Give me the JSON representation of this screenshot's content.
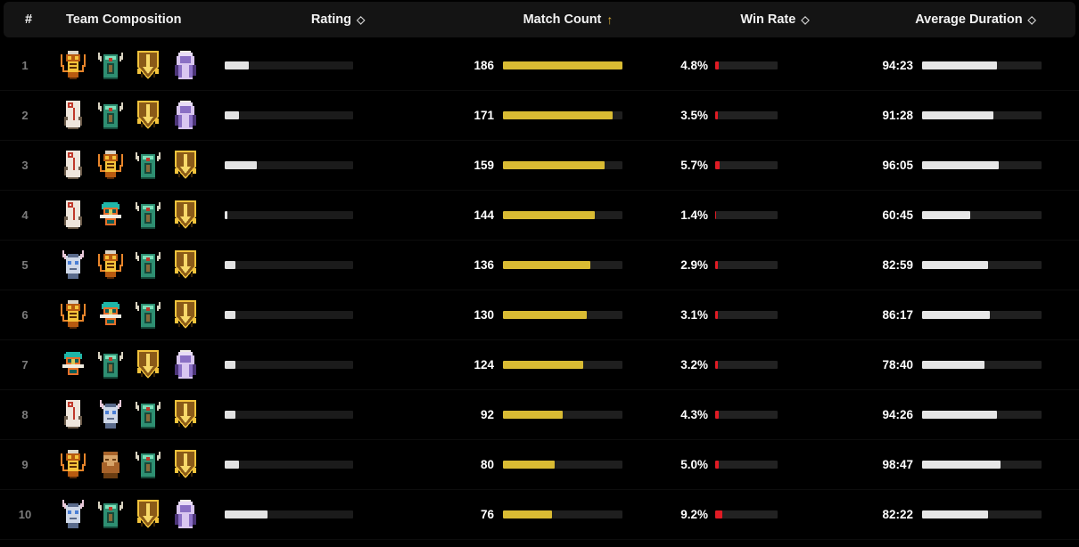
{
  "header": {
    "columns": [
      {
        "label": "#",
        "sort": "none",
        "align": "center"
      },
      {
        "label": "Team Composition",
        "sort": "none",
        "align": "left"
      },
      {
        "label": "Rating",
        "sort": "sortable",
        "align": "center"
      },
      {
        "label": "Match Count",
        "sort": "asc",
        "align": "center"
      },
      {
        "label": "Win Rate",
        "sort": "sortable",
        "align": "center"
      },
      {
        "label": "Average Duration",
        "sort": "sortable",
        "align": "center"
      }
    ],
    "sort_neutral_glyph": "◇",
    "sort_asc_glyph": "↑"
  },
  "colors": {
    "background": "#000000",
    "header_bg": "#141414",
    "rating_bar": "#e3e3e3",
    "match_bar": "#d9bb33",
    "winrate_bar": "#e01b24",
    "duration_bar": "#e6e6e6",
    "track": "#1f1f1f",
    "sort_active": "#e0b13a",
    "rank_text": "#7c7c7c",
    "value_text": "#ffffff"
  },
  "units": {
    "orange-demon": {
      "name": "orange-demon-unit",
      "body": "#b85a10",
      "accent": "#f5c33a",
      "dark": "#5a2a06",
      "horn": "#e8852a"
    },
    "green-horned": {
      "name": "green-horned-unit",
      "body": "#2e8f72",
      "accent": "#7fe0bb",
      "dark": "#15493a",
      "horn": "#d8d2c0"
    },
    "gold-shield": {
      "name": "gold-shield-unit",
      "body": "#8a5a18",
      "accent": "#f2c33c",
      "dark": "#3f2708",
      "horn": "#f7d96a"
    },
    "purple-robe": {
      "name": "purple-robe-unit",
      "body": "#8a6fc4",
      "accent": "#d9c6f0",
      "dark": "#4b3477",
      "horn": "#e8dcf7"
    },
    "white-scroll": {
      "name": "white-scroll-unit",
      "body": "#efe6dc",
      "accent": "#c0392b",
      "dark": "#6b5b4a",
      "horn": "#efe6dc"
    },
    "teal-masked": {
      "name": "teal-masked-unit",
      "body": "#1fb6a8",
      "accent": "#e8702a",
      "dark": "#0d5e57",
      "horn": "#f0ece0"
    },
    "blue-face": {
      "name": "blue-face-unit",
      "body": "#cfd8e8",
      "accent": "#4a7fd6",
      "dark": "#5a6b8c",
      "horn": "#e8c8d8"
    },
    "bearded-man": {
      "name": "bearded-warrior-unit",
      "body": "#d8a56a",
      "accent": "#a8632a",
      "dark": "#6b3d12",
      "horn": "#e8c89a"
    }
  },
  "rows": [
    {
      "rank": "1",
      "team": [
        "orange-demon",
        "green-horned",
        "gold-shield",
        "purple-robe"
      ],
      "rating": {
        "value": "",
        "pct": 19
      },
      "match": {
        "value": "186",
        "pct": 100
      },
      "win": {
        "value": "4.8%",
        "pct": 6
      },
      "duration": {
        "value": "94:23",
        "pct": 63
      }
    },
    {
      "rank": "2",
      "team": [
        "white-scroll",
        "green-horned",
        "gold-shield",
        "purple-robe"
      ],
      "rating": {
        "value": "",
        "pct": 11
      },
      "match": {
        "value": "171",
        "pct": 92
      },
      "win": {
        "value": "3.5%",
        "pct": 4
      },
      "duration": {
        "value": "91:28",
        "pct": 60
      }
    },
    {
      "rank": "3",
      "team": [
        "white-scroll",
        "orange-demon",
        "green-horned",
        "gold-shield"
      ],
      "rating": {
        "value": "",
        "pct": 25
      },
      "match": {
        "value": "159",
        "pct": 85
      },
      "win": {
        "value": "5.7%",
        "pct": 7
      },
      "duration": {
        "value": "96:05",
        "pct": 64
      }
    },
    {
      "rank": "4",
      "team": [
        "white-scroll",
        "teal-masked",
        "green-horned",
        "gold-shield"
      ],
      "rating": {
        "value": "",
        "pct": 2
      },
      "match": {
        "value": "144",
        "pct": 77
      },
      "win": {
        "value": "1.4%",
        "pct": 2
      },
      "duration": {
        "value": "60:45",
        "pct": 40
      }
    },
    {
      "rank": "5",
      "team": [
        "blue-face",
        "orange-demon",
        "green-horned",
        "gold-shield"
      ],
      "rating": {
        "value": "",
        "pct": 8
      },
      "match": {
        "value": "136",
        "pct": 73
      },
      "win": {
        "value": "2.9%",
        "pct": 4
      },
      "duration": {
        "value": "82:59",
        "pct": 55
      }
    },
    {
      "rank": "6",
      "team": [
        "orange-demon",
        "teal-masked",
        "green-horned",
        "gold-shield"
      ],
      "rating": {
        "value": "",
        "pct": 8
      },
      "match": {
        "value": "130",
        "pct": 70
      },
      "win": {
        "value": "3.1%",
        "pct": 4
      },
      "duration": {
        "value": "86:17",
        "pct": 57
      }
    },
    {
      "rank": "7",
      "team": [
        "teal-masked",
        "green-horned",
        "gold-shield",
        "purple-robe"
      ],
      "rating": {
        "value": "",
        "pct": 8
      },
      "match": {
        "value": "124",
        "pct": 67
      },
      "win": {
        "value": "3.2%",
        "pct": 4
      },
      "duration": {
        "value": "78:40",
        "pct": 52
      }
    },
    {
      "rank": "8",
      "team": [
        "white-scroll",
        "blue-face",
        "green-horned",
        "gold-shield"
      ],
      "rating": {
        "value": "",
        "pct": 8
      },
      "match": {
        "value": "92",
        "pct": 50
      },
      "win": {
        "value": "4.3%",
        "pct": 5
      },
      "duration": {
        "value": "94:26",
        "pct": 63
      }
    },
    {
      "rank": "9",
      "team": [
        "orange-demon",
        "bearded-man",
        "green-horned",
        "gold-shield"
      ],
      "rating": {
        "value": "",
        "pct": 11
      },
      "match": {
        "value": "80",
        "pct": 43
      },
      "win": {
        "value": "5.0%",
        "pct": 6
      },
      "duration": {
        "value": "98:47",
        "pct": 66
      }
    },
    {
      "rank": "10",
      "team": [
        "blue-face",
        "green-horned",
        "gold-shield",
        "purple-robe"
      ],
      "rating": {
        "value": "",
        "pct": 33
      },
      "match": {
        "value": "76",
        "pct": 41
      },
      "win": {
        "value": "9.2%",
        "pct": 11
      },
      "duration": {
        "value": "82:22",
        "pct": 55
      }
    }
  ]
}
